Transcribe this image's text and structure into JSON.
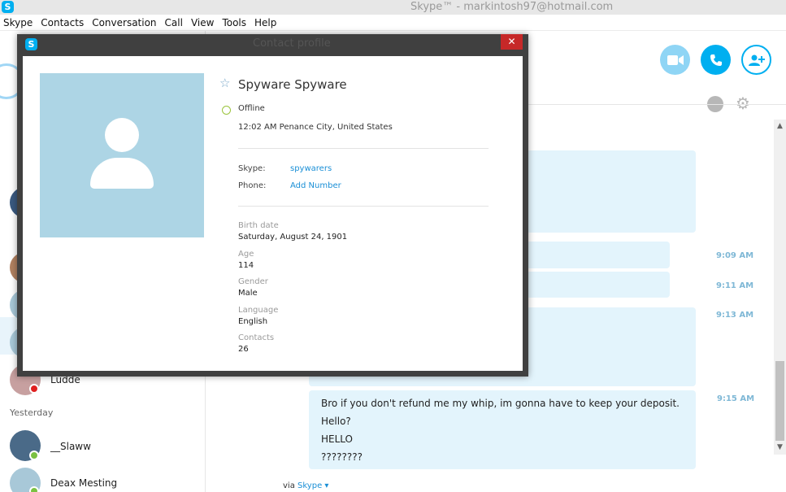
{
  "window": {
    "title": "Skype™ - markintosh97@hotmail.com",
    "logo": "S"
  },
  "menu": [
    "Skype",
    "Contacts",
    "Conversation",
    "Call",
    "View",
    "Tools",
    "Help"
  ],
  "sidebar": {
    "contacts": [
      {
        "name": "Ludde",
        "status": "busy"
      },
      {
        "name": "__Slaww",
        "status": "online"
      },
      {
        "name": "Deax Mesting",
        "status": "online"
      }
    ],
    "section_yesterday": "Yesterday"
  },
  "chat": {
    "times": [
      "9:09 AM",
      "9:11 AM",
      "9:13 AM",
      "9:15 AM"
    ],
    "last_message_lines": [
      "Bro if you don't refund me my whip, im gonna have to keep your deposit.",
      "Hello?",
      "HELLO",
      "????????"
    ],
    "via_prefix": "via",
    "via_link": "Skype ▾"
  },
  "colors": {
    "accent": "#00aff0",
    "bubble": "#e3f4fc",
    "close_button": "#c62828",
    "offline_ring": "#9bc43d"
  },
  "icons": {
    "video": "video-call-icon",
    "call": "phone-icon",
    "add": "add-contact-icon",
    "globe": "globe-icon",
    "settings": "gear-icon",
    "favorite": "star-icon"
  },
  "dialog": {
    "title": "Contact profile",
    "close": "✕",
    "profile": {
      "name": "Spyware Spyware",
      "status": "Offline",
      "location": "12:02 AM Penance City, United States",
      "skype_label": "Skype:",
      "skype_value": "spywarers",
      "phone_label": "Phone:",
      "phone_value": "Add Number",
      "birth_caption": "Birth date",
      "birth_value": "Saturday, August 24, 1901",
      "age_caption": "Age",
      "age_value": "114",
      "gender_caption": "Gender",
      "gender_value": "Male",
      "language_caption": "Language",
      "language_value": "English",
      "contacts_caption": "Contacts",
      "contacts_value": "26"
    }
  }
}
